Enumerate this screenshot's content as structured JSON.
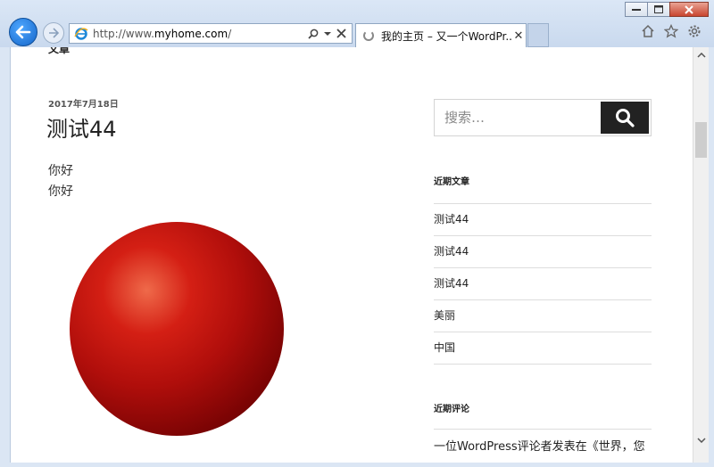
{
  "browser": {
    "address_url_prefix": "http://www.",
    "address_url_domain": "myhome.com",
    "address_url_suffix": "/",
    "tab_title": "我的主页 – 又一个WordPr..."
  },
  "page": {
    "cut_off_heading": "文章",
    "post": {
      "date": "2017年7月18日",
      "title": "测试44",
      "body_lines": [
        "你好",
        "你好"
      ]
    },
    "sidebar": {
      "search_placeholder": "搜索…",
      "recent_posts_title": "近期文章",
      "recent_posts": [
        "测试44",
        "测试44",
        "测试44",
        "美丽",
        "中国"
      ],
      "recent_comments_title": "近期评论",
      "recent_comment_text": "一位WordPress评论者发表在《世界，您"
    },
    "colors": {
      "search_button_bg": "#222222",
      "sphere_red": "#c0100c"
    }
  }
}
